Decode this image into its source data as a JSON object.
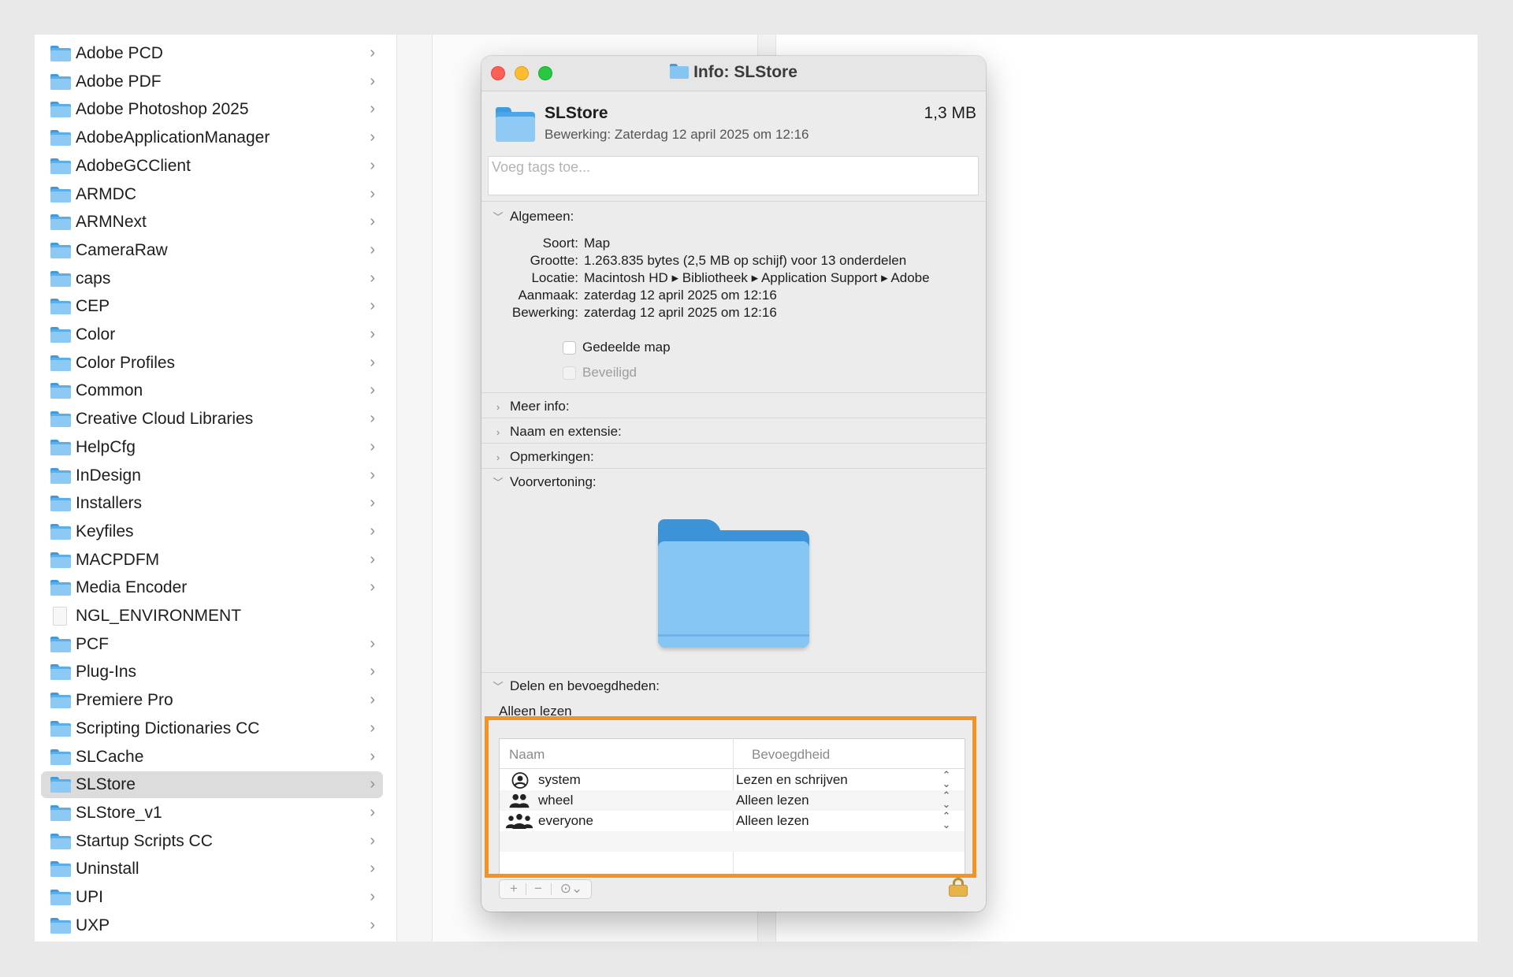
{
  "finder": {
    "items": [
      {
        "label": "Adobe PCD",
        "type": "folder",
        "chevron": true
      },
      {
        "label": "Adobe PDF",
        "type": "folder",
        "chevron": true
      },
      {
        "label": "Adobe Photoshop 2025",
        "type": "folder",
        "chevron": true
      },
      {
        "label": "AdobeApplicationManager",
        "type": "folder",
        "chevron": true
      },
      {
        "label": "AdobeGCClient",
        "type": "folder",
        "chevron": true
      },
      {
        "label": "ARMDC",
        "type": "folder",
        "chevron": true
      },
      {
        "label": "ARMNext",
        "type": "folder",
        "chevron": true
      },
      {
        "label": "CameraRaw",
        "type": "folder",
        "chevron": true
      },
      {
        "label": "caps",
        "type": "folder",
        "chevron": true
      },
      {
        "label": "CEP",
        "type": "folder",
        "chevron": true
      },
      {
        "label": "Color",
        "type": "folder",
        "chevron": true
      },
      {
        "label": "Color Profiles",
        "type": "folder",
        "chevron": true
      },
      {
        "label": "Common",
        "type": "folder",
        "chevron": true
      },
      {
        "label": "Creative Cloud Libraries",
        "type": "folder",
        "chevron": true
      },
      {
        "label": "HelpCfg",
        "type": "folder",
        "chevron": true
      },
      {
        "label": "InDesign",
        "type": "folder",
        "chevron": true
      },
      {
        "label": "Installers",
        "type": "folder",
        "chevron": true
      },
      {
        "label": "Keyfiles",
        "type": "folder",
        "chevron": true
      },
      {
        "label": "MACPDFM",
        "type": "folder",
        "chevron": true
      },
      {
        "label": "Media Encoder",
        "type": "folder",
        "chevron": true
      },
      {
        "label": "NGL_ENVIRONMENT",
        "type": "file",
        "chevron": false
      },
      {
        "label": "PCF",
        "type": "folder",
        "chevron": true
      },
      {
        "label": "Plug-Ins",
        "type": "folder",
        "chevron": true
      },
      {
        "label": "Premiere Pro",
        "type": "folder",
        "chevron": true
      },
      {
        "label": "Scripting Dictionaries CC",
        "type": "folder",
        "chevron": true
      },
      {
        "label": "SLCache",
        "type": "folder",
        "chevron": true
      },
      {
        "label": "SLStore",
        "type": "folder",
        "chevron": true,
        "selected": true
      },
      {
        "label": "SLStore_v1",
        "type": "folder",
        "chevron": true
      },
      {
        "label": "Startup Scripts CC",
        "type": "folder",
        "chevron": true
      },
      {
        "label": "Uninstall",
        "type": "folder",
        "chevron": true
      },
      {
        "label": "UPI",
        "type": "folder",
        "chevron": true
      },
      {
        "label": "UXP",
        "type": "folder",
        "chevron": true
      }
    ],
    "chevron_glyph": "›"
  },
  "info": {
    "title": "Info: SLStore",
    "name": "SLStore",
    "size": "1,3 MB",
    "modified_line": "Bewerking: Zaterdag 12 april 2025 om 12:16",
    "tags_placeholder": "Voeg tags toe...",
    "general": {
      "heading": "Algemeen:",
      "rows": [
        {
          "key": "Soort:",
          "value": "Map"
        },
        {
          "key": "Grootte:",
          "value": "1.263.835 bytes (2,5 MB op schijf) voor 13 onderdelen"
        },
        {
          "key": "Locatie:",
          "value": "Macintosh HD ▸ Bibliotheek ▸ Application Support ▸ Adobe"
        },
        {
          "key": "Aanmaak:",
          "value": "zaterdag 12 april 2025 om 12:16"
        },
        {
          "key": "Bewerking:",
          "value": "zaterdag 12 april 2025 om 12:16"
        }
      ],
      "shared_folder": "Gedeelde map",
      "locked": "Beveiligd"
    },
    "more_info": "Meer info:",
    "name_ext": "Naam en extensie:",
    "comments": "Opmerkingen:",
    "preview": "Voorvertoning:",
    "sharing": {
      "heading": "Delen en bevoegdheden:",
      "status": "Alleen lezen",
      "col_name": "Naam",
      "col_perm": "Bevoegdheid",
      "rows": [
        {
          "name": "system",
          "perm": "Lezen en schrijven",
          "icon": "user-icon"
        },
        {
          "name": "wheel",
          "perm": "Alleen lezen",
          "icon": "group-icon"
        },
        {
          "name": "everyone",
          "perm": "Alleen lezen",
          "icon": "everyone-icon"
        }
      ]
    },
    "toolbar": {
      "add": "+",
      "remove": "−",
      "action": "⊙⌄"
    }
  },
  "colors": {
    "highlight": "#f39322",
    "folder": "#86c6f4",
    "selection": "#dcdcdc"
  }
}
